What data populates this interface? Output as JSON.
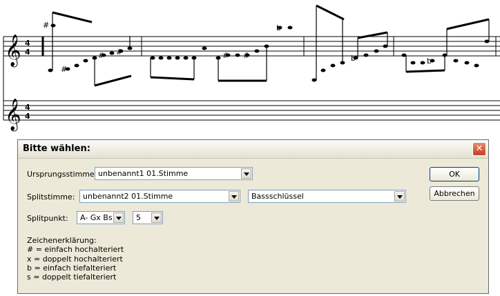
{
  "dialog": {
    "title": "Bitte wählen:",
    "close_symbol": "✕",
    "origin_label": "Ursprungsstimme:",
    "origin_value": "unbenannt1 01.Stimme",
    "split_label": "Splitstimme:",
    "split_value": "unbenannt2 01.Stimme",
    "clef_value": "Bassschlüssel",
    "splitpoint_label": "Splitpunkt:",
    "note_value": "A- Gx Bs",
    "octave_value": "5",
    "ok_label": "OK",
    "cancel_label": "Abbrechen",
    "legend": [
      "Zeichenerklärung:",
      "# = einfach hochalteriert",
      "x = doppelt hochalteriert",
      "b = einfach tiefalteriert",
      "s = doppelt tiefalteriert"
    ]
  },
  "score": {
    "time_signature_top": "4",
    "time_signature_bottom": "4"
  }
}
